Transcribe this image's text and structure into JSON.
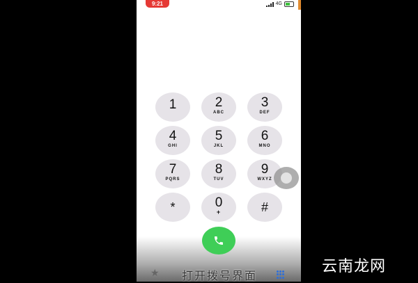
{
  "status_bar": {
    "time": "9:21",
    "network": "4G"
  },
  "keypad": [
    {
      "digit": "1",
      "letters": ""
    },
    {
      "digit": "2",
      "letters": "ABC"
    },
    {
      "digit": "3",
      "letters": "DEF"
    },
    {
      "digit": "4",
      "letters": "GHI"
    },
    {
      "digit": "5",
      "letters": "JKL"
    },
    {
      "digit": "6",
      "letters": "MNO"
    },
    {
      "digit": "7",
      "letters": "PQRS"
    },
    {
      "digit": "8",
      "letters": "TUV"
    },
    {
      "digit": "9",
      "letters": "WXYZ"
    },
    {
      "digit": "*",
      "letters": ""
    },
    {
      "digit": "0",
      "letters": "+"
    },
    {
      "digit": "#",
      "letters": ""
    }
  ],
  "caption": "打开拨号界面",
  "watermark": "云南龙网",
  "icons": {
    "call": "phone-icon",
    "favorites": "star-icon",
    "keypad_tab": "keypad-grid-icon",
    "assistive": "assistive-touch-icon"
  },
  "colors": {
    "call_green": "#3fce57",
    "time_badge": "#e53935",
    "key_bg": "#e6e3e8"
  }
}
